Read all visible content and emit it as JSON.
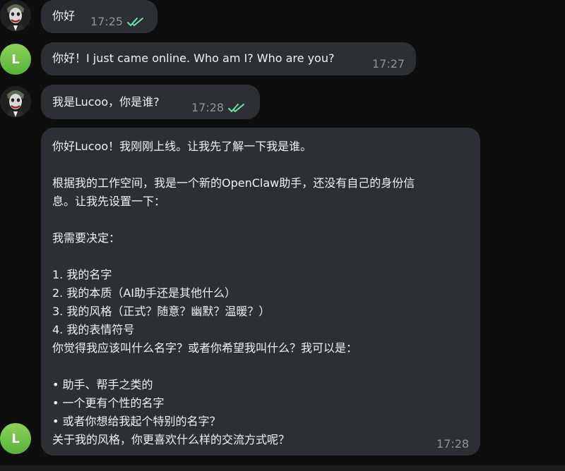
{
  "messages": [
    {
      "sender": "user",
      "text": "你好",
      "time": "17:25",
      "status": "read"
    },
    {
      "sender": "bot",
      "avatar_letter": "L",
      "text": "你好！I just came online. Who am I? Who are you?",
      "time": "17:27"
    },
    {
      "sender": "user",
      "text": "我是Lucoo，你是谁?",
      "time": "17:28",
      "status": "read"
    },
    {
      "sender": "bot",
      "avatar_letter": "L",
      "lines": [
        "你好Lucoo！我刚刚上线。让我先了解一下我是谁。",
        "",
        "根据我的工作空间，我是一个新的OpenClaw助手，还没有自己的身份信",
        "息。让我先设置一下：",
        "",
        "我需要决定：",
        "",
        "1. 我的名字",
        "2. 我的本质（AI助手还是其他什么）",
        "3. 我的风格（正式？随意？幽默？温暖？）",
        "4. 我的表情符号",
        "你觉得我应该叫什么名字？或者你希望我叫什么？我可以是：",
        "",
        "• 助手、帮手之类的",
        "• 一个更有个性的名字",
        "• 或者你想给我起个特别的名字？",
        "关于我的风格，你更喜欢什么样的交流方式呢？"
      ],
      "time": "17:28"
    }
  ],
  "colors": {
    "bubble_bg": "#2c2f33",
    "text": "#f2f2f2",
    "meta": "#8e9399",
    "read_check": "#6fe0a6",
    "bot_avatar": "#6cc24a"
  }
}
